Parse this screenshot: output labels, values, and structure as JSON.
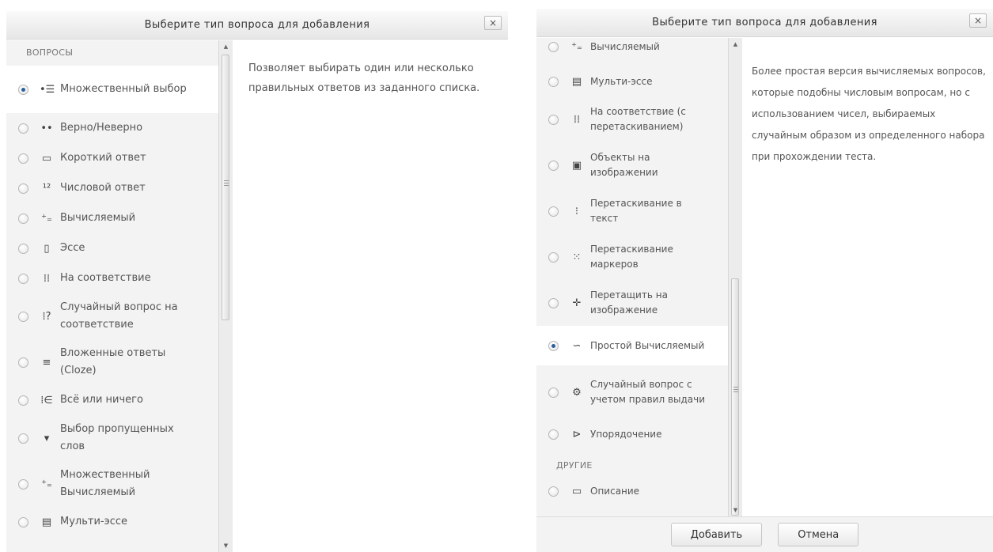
{
  "left": {
    "title": "Выберите тип вопроса для добавления",
    "close": "×",
    "section": "ВОПРОСЫ",
    "items": [
      {
        "label": "Множественный выбор",
        "icon": "multichoice-icon",
        "glyph": "•☰",
        "selected": true
      },
      {
        "label": "Верно/Неверно",
        "icon": "truefalse-icon",
        "glyph": "••"
      },
      {
        "label": "Короткий ответ",
        "icon": "shortanswer-icon",
        "glyph": "▭"
      },
      {
        "label": "Числовой ответ",
        "icon": "numerical-icon",
        "glyph": "¹²"
      },
      {
        "label": "Вычисляемый",
        "icon": "calculated-icon",
        "glyph": "⁺₌"
      },
      {
        "label": "Эссе",
        "icon": "essay-icon",
        "glyph": "▯"
      },
      {
        "label": "На соответствие",
        "icon": "match-icon",
        "glyph": "⁞⁞"
      },
      {
        "label": "Случайный вопрос на соответствие",
        "icon": "randomsamatch-icon",
        "glyph": "⁞?"
      },
      {
        "label": "Вложенные ответы (Cloze)",
        "icon": "multianswer-icon",
        "glyph": "≡"
      },
      {
        "label": "Всё или ничего",
        "icon": "allornothing-icon",
        "glyph": "⁞∈"
      },
      {
        "label": "Выбор пропущенных слов",
        "icon": "gapselect-icon",
        "glyph": "▾"
      },
      {
        "label": "Множественный Вычисляемый",
        "icon": "calculatedmulti-icon",
        "glyph": "⁺₌"
      },
      {
        "label": "Мульти-эссе",
        "icon": "multiessay-icon",
        "glyph": "▤"
      }
    ],
    "description": "Позволяет выбирать один или несколько правильных ответов из заданного списка."
  },
  "right": {
    "title": "Выберите тип вопроса для добавления",
    "close": "×",
    "items": [
      {
        "label": "Вычисляемый",
        "icon": "calculated-icon",
        "glyph": "⁺₌"
      },
      {
        "label": "Мульти-эссе",
        "icon": "multiessay-icon",
        "glyph": "▤"
      },
      {
        "label": "На соответствие (с перетаскиванием)",
        "icon": "ddmatch-icon",
        "glyph": "⁞⁞"
      },
      {
        "label": "Объекты на изображении",
        "icon": "imagetarget-icon",
        "glyph": "▣"
      },
      {
        "label": "Перетаскивание в текст",
        "icon": "ddwtos-icon",
        "glyph": "⁝"
      },
      {
        "label": "Перетаскивание маркеров",
        "icon": "ddmarker-icon",
        "glyph": "⁙"
      },
      {
        "label": "Перетащить на изображение",
        "icon": "ddimageortext-icon",
        "glyph": "✛"
      },
      {
        "label": "Простой Вычисляемый",
        "icon": "calculatedsimple-icon",
        "glyph": "∽",
        "selected": true
      },
      {
        "label": "Случайный вопрос с учетом правил выдачи",
        "icon": "randomconstrained-icon",
        "glyph": "⚙"
      },
      {
        "label": "Упорядочение",
        "icon": "ordering-icon",
        "glyph": "⊳"
      }
    ],
    "section_other": "ДРУГИЕ",
    "other_items": [
      {
        "label": "Описание",
        "icon": "description-icon",
        "glyph": "▭"
      }
    ],
    "description": "Более простая версия вычисляемых вопросов, которые подобны числовым вопросам, но с использованием чисел, выбираемых случайным образом из определенного набора при прохождении теста.",
    "add_button": "Добавить",
    "cancel_button": "Отмена"
  }
}
